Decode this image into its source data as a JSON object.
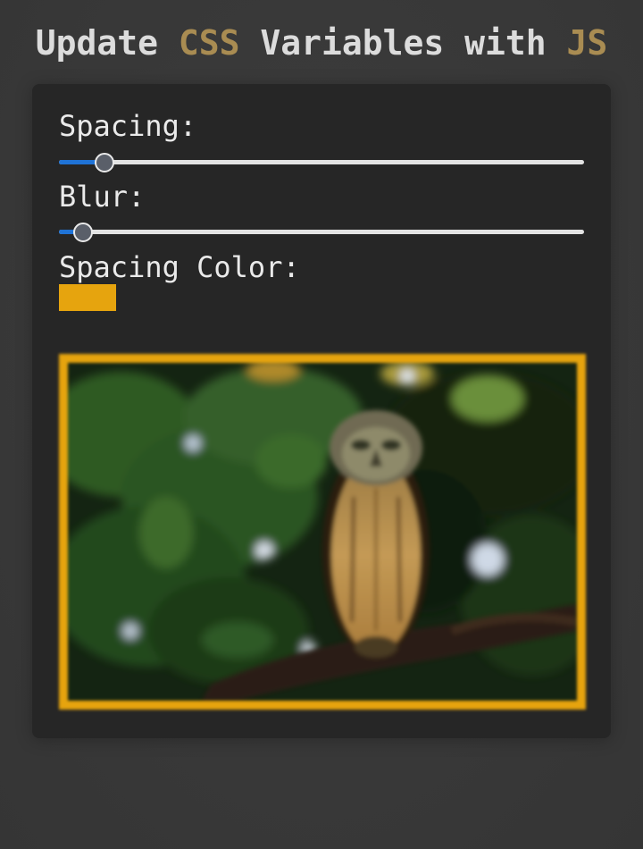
{
  "header": {
    "title_part1": "Update ",
    "title_accent1": "CSS",
    "title_part2": " Variables with ",
    "title_accent2": "JS"
  },
  "controls": {
    "spacing": {
      "label": "Spacing:",
      "value_fraction": 0.085
    },
    "blur": {
      "label": "Blur:",
      "value_fraction": 0.045
    },
    "spacing_color": {
      "label": "Spacing Color:",
      "value": "#e6a40e"
    }
  },
  "image": {
    "subject": "owl-photo",
    "border_color": "#e6a40e"
  },
  "colors": {
    "accent": "#a98c52",
    "background": "#383838",
    "panel": "#262626",
    "slider_fill": "#1f73d6"
  }
}
